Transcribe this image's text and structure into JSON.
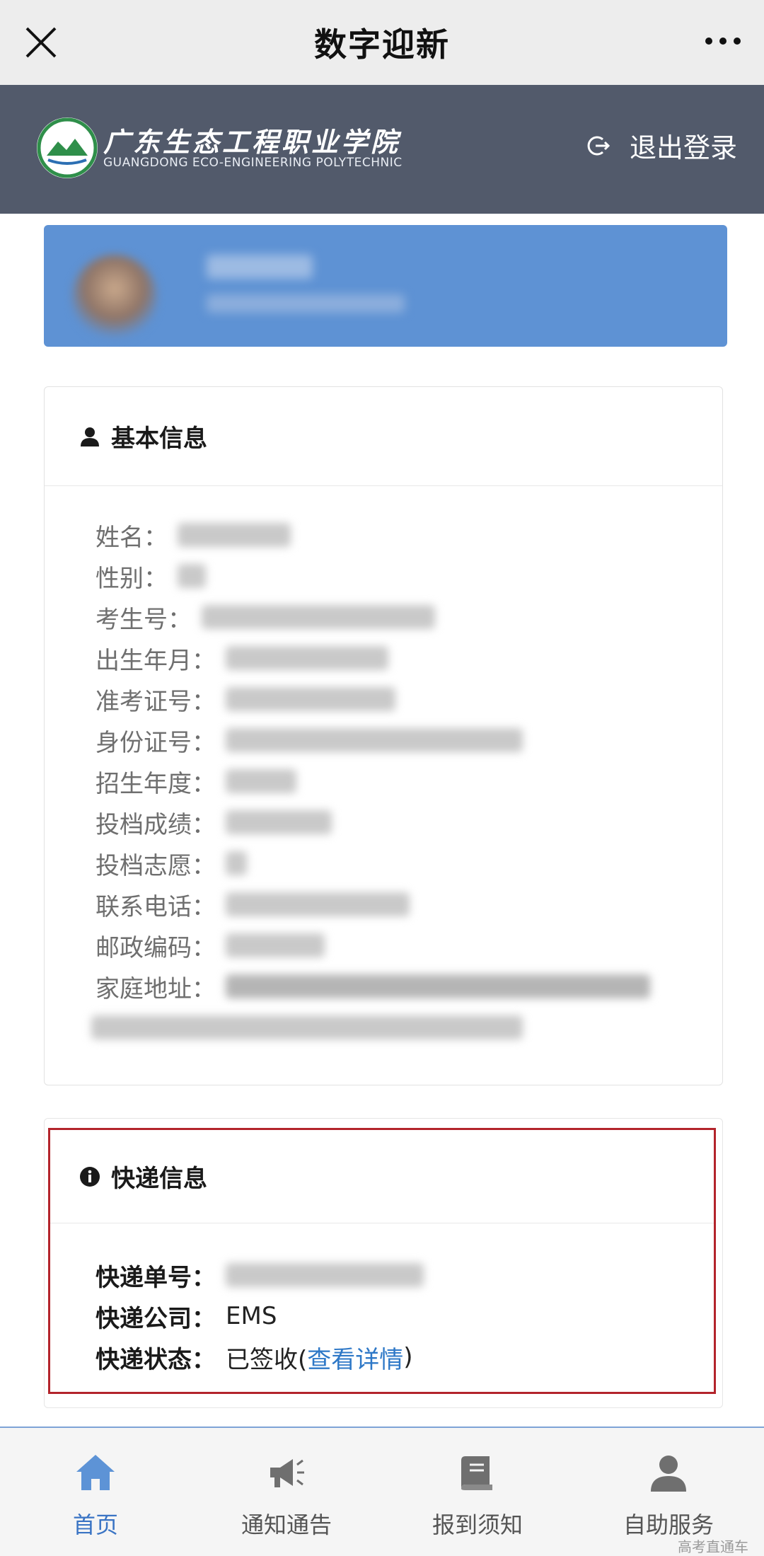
{
  "topbar": {
    "title": "数字迎新",
    "close_icon": "close-icon",
    "more_icon": "more-dots-icon"
  },
  "header": {
    "school_cn": "广东生态工程职业学院",
    "school_en": "GUANGDONG ECO-ENGINEERING POLYTECHNIC",
    "logout_label": "退出登录"
  },
  "basic_info": {
    "title": "基本信息",
    "fields": [
      {
        "label": "姓名："
      },
      {
        "label": "性别："
      },
      {
        "label": "考生号："
      },
      {
        "label": "出生年月："
      },
      {
        "label": "准考证号："
      },
      {
        "label": "身份证号："
      },
      {
        "label": "招生年度："
      },
      {
        "label": "投档成绩："
      },
      {
        "label": "投档志愿："
      },
      {
        "label": "联系电话："
      },
      {
        "label": "邮政编码："
      },
      {
        "label": "家庭地址："
      }
    ]
  },
  "express": {
    "title": "快递信息",
    "tracking_label": "快递单号：",
    "company_label": "快递公司：",
    "company_value": "EMS",
    "status_label": "快递状态：",
    "status_value": "已签收(",
    "detail_link": "查看详情",
    "status_close": ")"
  },
  "tabs": [
    {
      "label": "首页",
      "icon": "home-icon",
      "active": true
    },
    {
      "label": "通知通告",
      "icon": "megaphone-icon",
      "active": false
    },
    {
      "label": "报到须知",
      "icon": "book-icon",
      "active": false
    },
    {
      "label": "自助服务",
      "icon": "user-icon",
      "active": false
    }
  ],
  "watermark": "高考直通车",
  "colors": {
    "header_bg": "#525a6b",
    "profile_bg": "#5e92d4",
    "accent": "#3a74c4",
    "highlight_border": "#b3242b"
  }
}
